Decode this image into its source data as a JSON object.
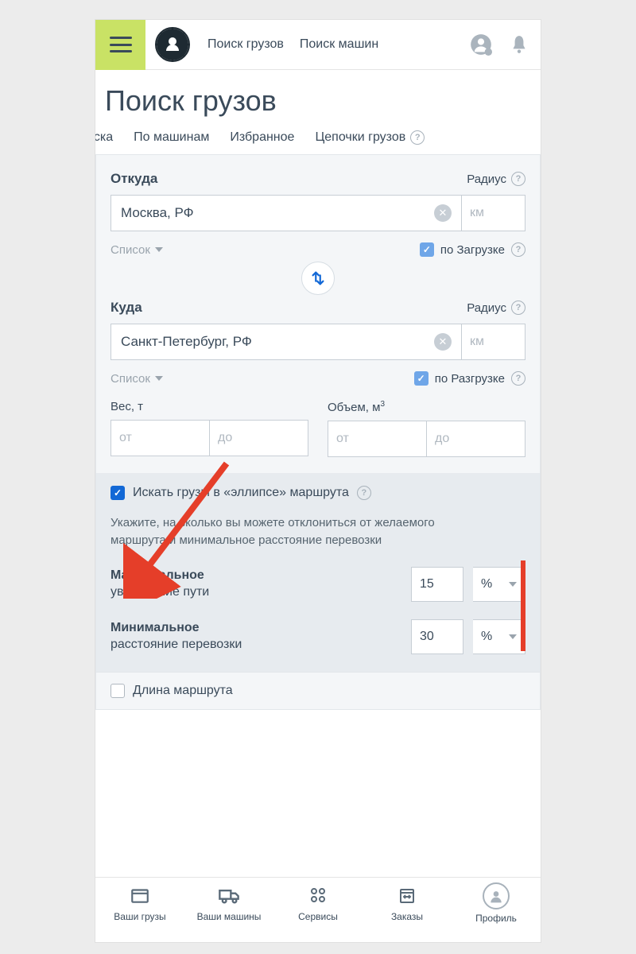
{
  "header": {
    "nav1": "Поиск грузов",
    "nav2": "Поиск машин"
  },
  "pageTitle": "Поиск грузов",
  "tabs": {
    "t1_partial": "оиска",
    "t2": "По машинам",
    "t3": "Избранное",
    "t4": "Цепочки грузов"
  },
  "from": {
    "label": "Откуда",
    "radius": "Радиус",
    "value": "Москва, РФ",
    "km": "км",
    "list": "Список",
    "byLoad": "по Загрузке"
  },
  "to": {
    "label": "Куда",
    "radius": "Радиус",
    "value": "Санкт-Петербург, РФ",
    "km": "км",
    "list": "Список",
    "byUnload": "по Разгрузке"
  },
  "weight": {
    "label": "Вес, т",
    "from": "от",
    "to": "до"
  },
  "volume": {
    "labelPrefix": "Объем, м",
    "labelSup": "3",
    "from": "от",
    "to": "до"
  },
  "ellipse": {
    "title": "Искать грузы в «эллипсе» маршрута",
    "desc": "Укажите, на сколько вы можете отклониться от желаемого маршрута и минимальное расстояние перевозки",
    "maxBold": "Максимальное",
    "maxRest": "увеличение пути",
    "maxVal": "15",
    "maxUnit": "%",
    "minBold": "Минимальное",
    "minRest": "расстояние перевозки",
    "minVal": "30",
    "minUnit": "%"
  },
  "routeLen": "Длина маршрута",
  "bottomNav": {
    "n1": "Ваши грузы",
    "n2": "Ваши машины",
    "n3": "Сервисы",
    "n4": "Заказы",
    "n5": "Профиль"
  }
}
